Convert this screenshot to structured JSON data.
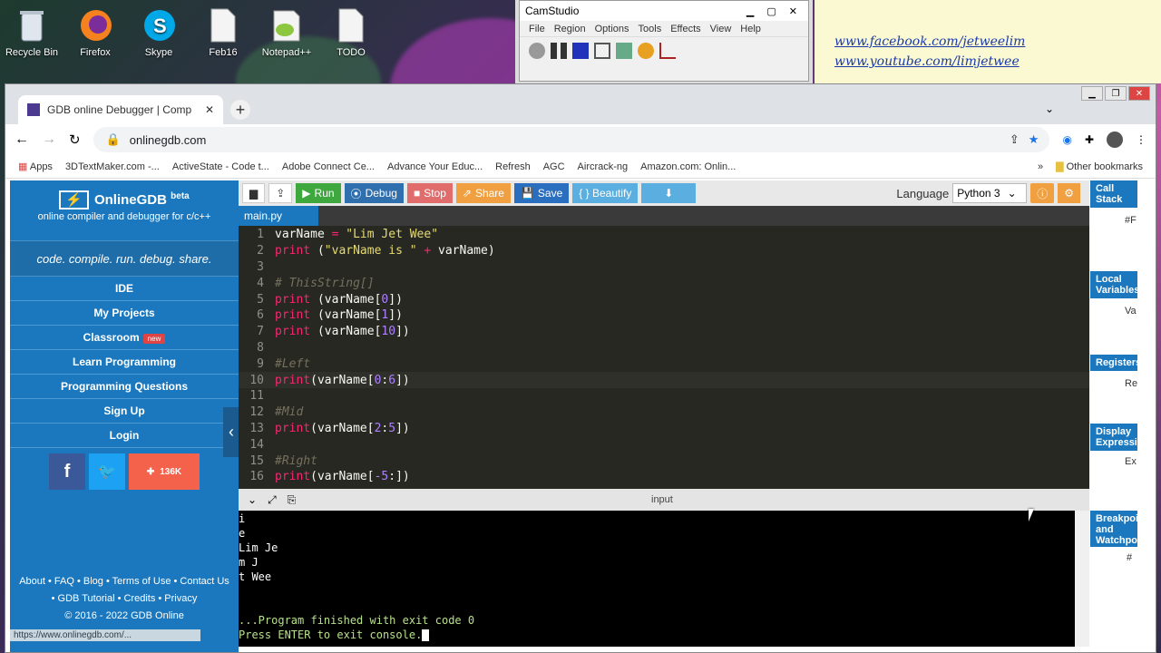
{
  "desktop": {
    "icons": [
      {
        "label": "Recycle Bin",
        "icon": "recycle-bin-icon"
      },
      {
        "label": "Firefox",
        "icon": "firefox-icon"
      },
      {
        "label": "Skype",
        "icon": "skype-icon"
      },
      {
        "label": "Feb16",
        "icon": "document-icon"
      },
      {
        "label": "Notepad++",
        "icon": "notepad-icon"
      },
      {
        "label": "TODO",
        "icon": "document-icon"
      }
    ],
    "links": [
      "www.facebook.com/jetweelim",
      "www.youtube.com/limjetwee"
    ]
  },
  "camstudio": {
    "title": "CamStudio",
    "menu": [
      "File",
      "Region",
      "Options",
      "Tools",
      "Effects",
      "View",
      "Help"
    ]
  },
  "browser": {
    "tab_title": "GDB online Debugger | Compiler",
    "url": "onlinegdb.com",
    "bookmarks": [
      "Apps",
      "3DTextMaker.com -...",
      "ActiveState - Code t...",
      "Adobe Connect Ce...",
      "Advance Your Educ...",
      "Refresh",
      "AGC",
      "Aircrack-ng",
      "Amazon.com: Onlin...",
      "Other bookmarks"
    ]
  },
  "sidebar": {
    "brand": "OnlineGDB",
    "brand_sup": "beta",
    "subtitle": "online compiler and debugger for c/c++",
    "tagline": "code. compile. run. debug. share.",
    "nav": [
      "IDE",
      "My Projects",
      "Classroom",
      "Learn Programming",
      "Programming Questions",
      "Sign Up",
      "Login"
    ],
    "classroom_badge": "new",
    "share_count": "136K",
    "footer_line1": "About • FAQ • Blog • Terms of Use • Contact Us",
    "footer_line2": "• GDB Tutorial • Credits • Privacy",
    "footer_line3": "© 2016 - 2022 GDB Online",
    "status_url": "https://www.onlinegdb.com/..."
  },
  "ide": {
    "buttons": {
      "run": "Run",
      "debug": "Debug",
      "stop": "Stop",
      "share": "Share",
      "save": "Save",
      "beautify": "{ } Beautify"
    },
    "language_label": "Language",
    "language": "Python 3",
    "file_tab": "main.py",
    "output_label": "input"
  },
  "code_lines": [
    "varName = \"Lim Jet Wee\"",
    "print (\"varName is \" + varName)",
    "",
    "# ThisString[]",
    "print (varName[0])",
    "print (varName[1])",
    "print (varName[10])",
    "",
    "#Left",
    "print(varName[0:6])",
    "",
    "#Mid",
    "print(varName[2:5])",
    "",
    "#Right",
    "print(varName[-5:])"
  ],
  "console_lines": [
    "i",
    "e",
    "Lim Je",
    "m J",
    "t Wee",
    "",
    "",
    "...Program finished with exit code 0",
    "Press ENTER to exit console."
  ],
  "right_panel": [
    {
      "title": "Call Stack",
      "value": "#F"
    },
    {
      "title": "Local Variables",
      "value": "Va"
    },
    {
      "title": "Registers",
      "value": "Re"
    },
    {
      "title": "Display Expressions",
      "value": "Ex"
    },
    {
      "title": "Breakpoints and Watchpoints",
      "value": "#"
    }
  ],
  "colors": {
    "brand_blue": "#1b78be",
    "run": "#3ea83e",
    "debug": "#2f6fae",
    "stop": "#e06c6c",
    "share": "#f0a040",
    "save": "#2a6ebf",
    "beautify": "#5aaee0"
  }
}
